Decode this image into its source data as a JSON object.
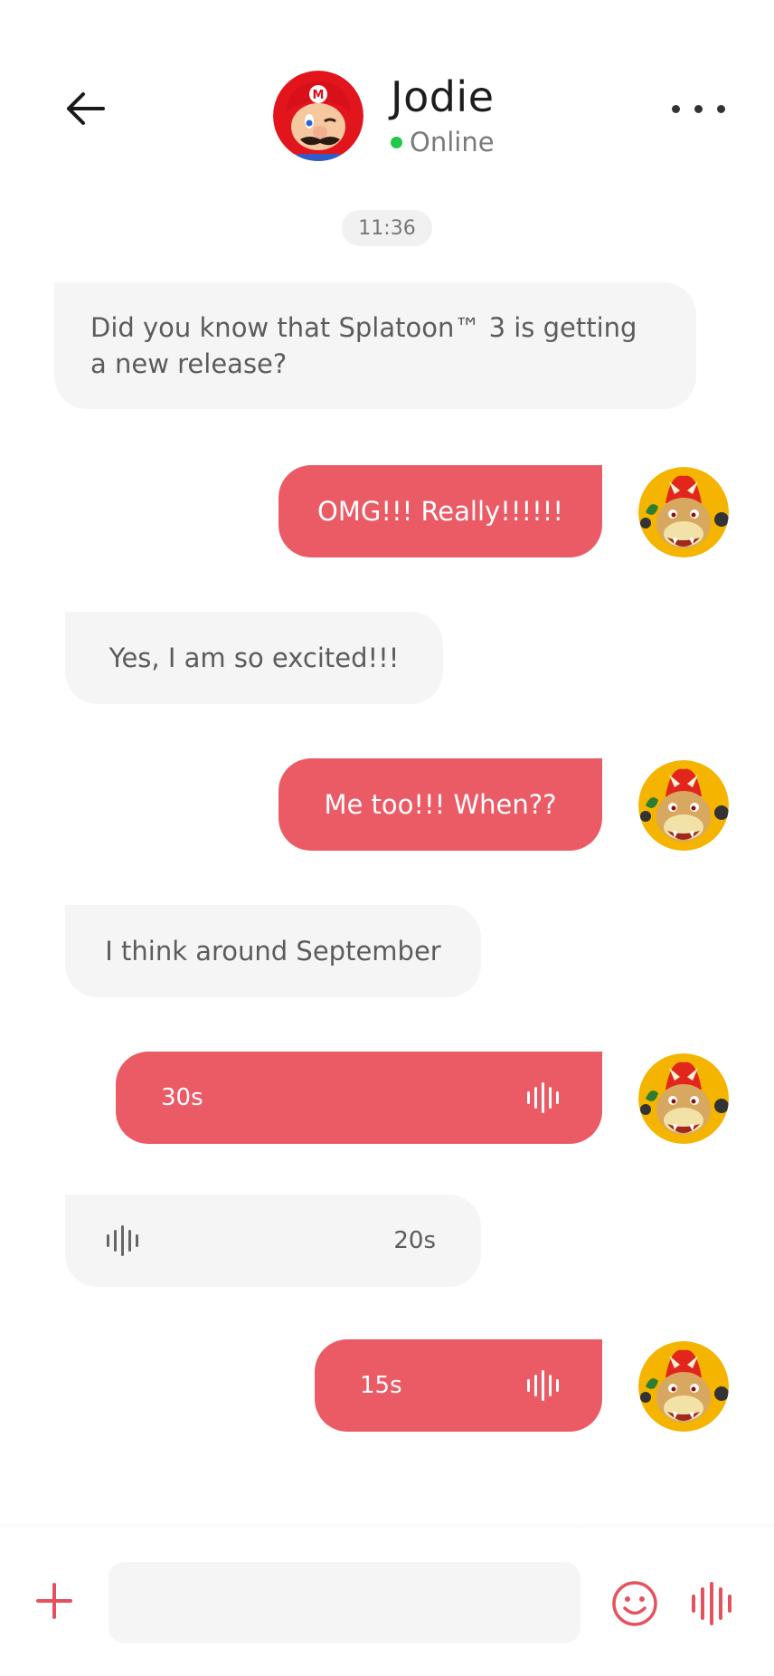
{
  "header": {
    "contact_name": "Jodie",
    "status": "Online",
    "status_color": "#22c84a"
  },
  "timestamp": "11:36",
  "colors": {
    "accent": "#eb5b66",
    "incoming_bubble": "#f5f5f5",
    "background": "#ffffff"
  },
  "messages": [
    {
      "direction": "incoming",
      "type": "text",
      "text": "Did you know that Splatoon™ 3 is getting a new release?"
    },
    {
      "direction": "outgoing",
      "type": "text",
      "text": "OMG!!! Really!!!!!!"
    },
    {
      "direction": "incoming",
      "type": "text",
      "text": "Yes, I am so excited!!!"
    },
    {
      "direction": "outgoing",
      "type": "text",
      "text": "Me too!!! When??"
    },
    {
      "direction": "incoming",
      "type": "text",
      "text": "I think around September"
    },
    {
      "direction": "outgoing",
      "type": "voice",
      "duration": "30s"
    },
    {
      "direction": "incoming",
      "type": "voice",
      "duration": "20s"
    },
    {
      "direction": "outgoing",
      "type": "voice",
      "duration": "15s"
    }
  ],
  "composer": {
    "input_value": "",
    "placeholder": "",
    "icons": [
      "plus-icon",
      "emoji-icon",
      "voice-wave-icon"
    ]
  }
}
